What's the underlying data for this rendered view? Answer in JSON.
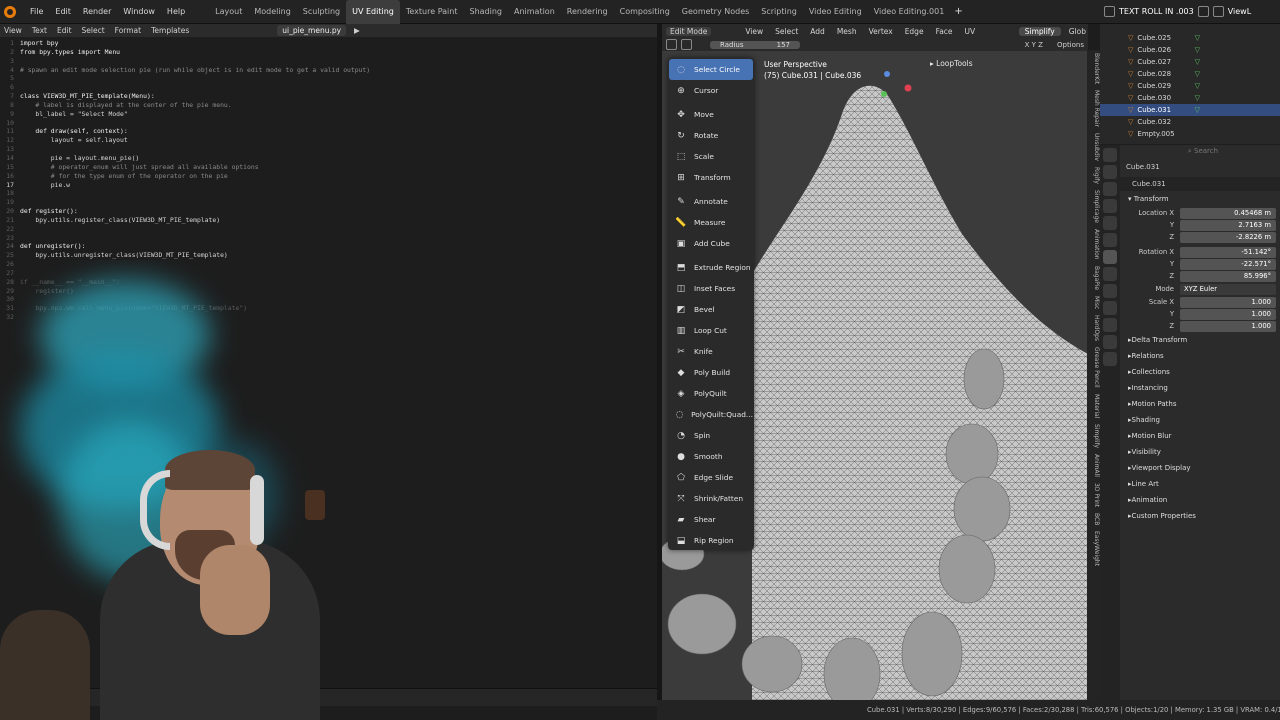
{
  "menubar": {
    "items": [
      "File",
      "Edit",
      "Render",
      "Window",
      "Help"
    ],
    "workspaces": [
      "Layout",
      "Modeling",
      "Sculpting",
      "UV Editing",
      "Texture Paint",
      "Shading",
      "Animation",
      "Rendering",
      "Compositing",
      "Geometry Nodes",
      "Scripting",
      "Video Editing",
      "Video Editing.001"
    ],
    "active_workspace": "UV Editing",
    "scene_name": "TEXT ROLL IN .003",
    "right_label": "ViewL"
  },
  "text_editor": {
    "menus": [
      "View",
      "Text",
      "Edit",
      "Select",
      "Format",
      "Templates"
    ],
    "filename": "ui_pie_menu.py",
    "lines": [
      {
        "n": "1",
        "t": "import bpy",
        "c": "kw"
      },
      {
        "n": "2",
        "t": "from bpy.types import Menu",
        "c": "kw"
      },
      {
        "n": "3",
        "t": "",
        "c": ""
      },
      {
        "n": "4",
        "t": "# spawn an edit mode selection pie (run while object is in edit mode to get a valid output)",
        "c": "cm"
      },
      {
        "n": "5",
        "t": "",
        "c": ""
      },
      {
        "n": "6",
        "t": "",
        "c": ""
      },
      {
        "n": "7",
        "t": "class VIEW3D_MT_PIE_template(Menu):",
        "c": "kw"
      },
      {
        "n": "8",
        "t": "    # label is displayed at the center of the pie menu.",
        "c": "cm"
      },
      {
        "n": "9",
        "t": "    bl_label = \"Select Mode\"",
        "c": ""
      },
      {
        "n": "10",
        "t": "",
        "c": ""
      },
      {
        "n": "11",
        "t": "    def draw(self, context):",
        "c": "kw"
      },
      {
        "n": "12",
        "t": "        layout = self.layout",
        "c": ""
      },
      {
        "n": "13",
        "t": "",
        "c": ""
      },
      {
        "n": "14",
        "t": "        pie = layout.menu_pie()",
        "c": ""
      },
      {
        "n": "15",
        "t": "        # operator_enum will just spread all available options",
        "c": "cm"
      },
      {
        "n": "16",
        "t": "        # for the type enum of the operator on the pie",
        "c": "cm"
      },
      {
        "n": "17",
        "t": "        pie.w",
        "c": ""
      },
      {
        "n": "18",
        "t": "",
        "c": ""
      },
      {
        "n": "19",
        "t": "",
        "c": ""
      },
      {
        "n": "20",
        "t": "def register():",
        "c": "kw"
      },
      {
        "n": "21",
        "t": "    bpy.utils.register_class(VIEW3D_MT_PIE_template)",
        "c": ""
      },
      {
        "n": "22",
        "t": "",
        "c": ""
      },
      {
        "n": "23",
        "t": "",
        "c": ""
      },
      {
        "n": "24",
        "t": "def unregister():",
        "c": "kw"
      },
      {
        "n": "25",
        "t": "    bpy.utils.unregister_class(VIEW3D_MT_PIE_template)",
        "c": ""
      },
      {
        "n": "26",
        "t": "",
        "c": ""
      },
      {
        "n": "27",
        "t": "",
        "c": ""
      },
      {
        "n": "28",
        "t": "if __name__ == \"__main__\":",
        "c": "dim"
      },
      {
        "n": "29",
        "t": "    register()",
        "c": "dim"
      },
      {
        "n": "30",
        "t": "",
        "c": ""
      },
      {
        "n": "31",
        "t": "    bpy.ops.wm.call_menu_pie(name=\"VIEW3D_MT_PIE_template\")",
        "c": "dim"
      },
      {
        "n": "32",
        "t": "",
        "c": ""
      }
    ],
    "current_line": "17"
  },
  "viewport": {
    "menus": [
      "View",
      "Select",
      "Add",
      "Mesh",
      "Vertex",
      "Edge",
      "Face",
      "UV"
    ],
    "mode": "Edit Mode",
    "radius_label": "Radius",
    "radius_value": "157",
    "simplify": "Simplify",
    "glob": "Glob",
    "options": "Options",
    "axes": "X Y Z",
    "perspective": "User Perspective",
    "object_info": "(75) Cube.031 | Cube.036",
    "looptools": "LoopTools"
  },
  "pie_menu": {
    "items": [
      {
        "label": "Select Circle",
        "icon": "select-circle-icon",
        "glyph": "◌",
        "active": true
      },
      {
        "label": "Cursor",
        "icon": "cursor-icon",
        "glyph": "⊕"
      },
      {
        "sep": true
      },
      {
        "label": "Move",
        "icon": "move-icon",
        "glyph": "✥"
      },
      {
        "label": "Rotate",
        "icon": "rotate-icon",
        "glyph": "↻"
      },
      {
        "label": "Scale",
        "icon": "scale-icon",
        "glyph": "⬚"
      },
      {
        "label": "Transform",
        "icon": "transform-icon",
        "glyph": "⊞"
      },
      {
        "sep": true
      },
      {
        "label": "Annotate",
        "icon": "annotate-icon",
        "glyph": "✎"
      },
      {
        "label": "Measure",
        "icon": "measure-icon",
        "glyph": "📏"
      },
      {
        "label": "Add Cube",
        "icon": "add-cube-icon",
        "glyph": "▣"
      },
      {
        "sep": true
      },
      {
        "label": "Extrude Region",
        "icon": "extrude-icon",
        "glyph": "⬒"
      },
      {
        "label": "Inset Faces",
        "icon": "inset-icon",
        "glyph": "◫"
      },
      {
        "label": "Bevel",
        "icon": "bevel-icon",
        "glyph": "◩"
      },
      {
        "label": "Loop Cut",
        "icon": "loop-cut-icon",
        "glyph": "▥"
      },
      {
        "label": "Knife",
        "icon": "knife-icon",
        "glyph": "✂"
      },
      {
        "label": "Poly Build",
        "icon": "poly-build-icon",
        "glyph": "◆"
      },
      {
        "label": "PolyQuilt",
        "icon": "polyquilt-icon",
        "glyph": "◈"
      },
      {
        "label": "PolyQuilt:Quad...",
        "icon": "polyquilt-quad-icon",
        "glyph": "◌"
      },
      {
        "label": "Spin",
        "icon": "spin-icon",
        "glyph": "◔"
      },
      {
        "label": "Smooth",
        "icon": "smooth-icon",
        "glyph": "●"
      },
      {
        "label": "Edge Slide",
        "icon": "edge-slide-icon",
        "glyph": "⬠"
      },
      {
        "label": "Shrink/Fatten",
        "icon": "shrink-fatten-icon",
        "glyph": "⤧"
      },
      {
        "label": "Shear",
        "icon": "shear-icon",
        "glyph": "▰"
      },
      {
        "label": "Rip Region",
        "icon": "rip-region-icon",
        "glyph": "⬓"
      }
    ]
  },
  "vertical_tabs": [
    "BlenderKit",
    "Mesh Repair",
    "Unsubdiv",
    "Rigify",
    "Simplicage",
    "Animation",
    "BagaPie",
    "Misc",
    "HardOps",
    "Grease Pencil",
    "Material",
    "Simplify",
    "AnimAll",
    "3D Print",
    "BCB",
    "EasyWeight"
  ],
  "outliner": {
    "rows": [
      {
        "name": "Cube.025",
        "sel": false
      },
      {
        "name": "Cube.026",
        "sel": false
      },
      {
        "name": "Cube.027",
        "sel": false
      },
      {
        "name": "Cube.028",
        "sel": false
      },
      {
        "name": "Cube.029",
        "sel": false
      },
      {
        "name": "Cube.030",
        "sel": false
      },
      {
        "name": "Cube.031",
        "sel": true
      },
      {
        "name": "Cube.032",
        "sel": false
      },
      {
        "name": "Empty.005",
        "sel": false
      }
    ],
    "search_placeholder": "Search"
  },
  "properties": {
    "search_placeholder": "Search",
    "object_name": "Cube.031",
    "data_name": "Cube.031",
    "transform_label": "Transform",
    "location_label": "Location X",
    "location": [
      "0.45468 m",
      "2.7163 m",
      "-2.8226 m"
    ],
    "rotation_label": "Rotation X",
    "rotation": [
      "-51.142°",
      "-22.571°",
      "85.996°"
    ],
    "mode_label": "Mode",
    "mode_value": "XYZ Euler",
    "scale_label": "Scale X",
    "scale": [
      "1.000",
      "1.000",
      "1.000"
    ],
    "y_label": "Y",
    "z_label": "Z",
    "sections": [
      "Delta Transform",
      "Relations",
      "Collections",
      "Instancing",
      "Motion Paths",
      "Shading",
      "Motion Blur",
      "Visibility",
      "Viewport Display",
      "Line Art",
      "Animation",
      "Custom Properties"
    ]
  },
  "statusbar": {
    "text": "Cube.031 | Verts:8/30,290 | Edges:9/60,576 | Faces:2/30,288 | Tris:60,576 | Objects:1/20 | Memory: 1.35 GB | VRAM: 0.4/11"
  },
  "colors": {
    "accent": "#4772b3",
    "selected_row": "#334d80",
    "orange": "#e87d0d"
  }
}
